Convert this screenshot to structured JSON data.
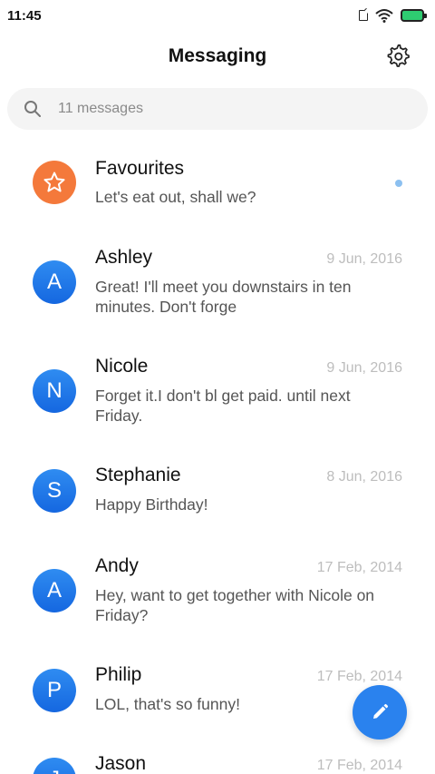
{
  "status_bar": {
    "time": "11:45"
  },
  "header": {
    "title": "Messaging"
  },
  "search": {
    "placeholder": "11 messages"
  },
  "conversations": [
    {
      "avatar": "star-icon",
      "name": "Favourites",
      "date": "",
      "preview": "Let's eat out, shall we?",
      "unread": true,
      "avatar_color": "#f4793b"
    },
    {
      "avatar": "A",
      "name": "Ashley",
      "date": "9 Jun, 2016",
      "preview": "Great! I'll meet you downstairs in ten minutes. Don't forge"
    },
    {
      "avatar": "N",
      "name": "Nicole",
      "date": "9 Jun, 2016",
      "preview": "Forget it.I don't bl get paid. until next Friday."
    },
    {
      "avatar": "S",
      "name": "Stephanie",
      "date": "8 Jun, 2016",
      "preview": "Happy Birthday!"
    },
    {
      "avatar": "A",
      "name": "Andy",
      "date": "17 Feb, 2014",
      "preview": "Hey, want to get together with Nicole on Friday?"
    },
    {
      "avatar": "P",
      "name": "Philip",
      "date": "17 Feb, 2014",
      "preview": "LOL, that's so funny!"
    },
    {
      "avatar": "J",
      "name": "Jason",
      "date": "17 Feb, 2014",
      "preview": ""
    }
  ],
  "fab": {
    "icon": "pencil-icon",
    "color": "#2a82ee"
  },
  "colors": {
    "avatar_blue": "#1e78ea",
    "unread_dot": "#8cc0f0"
  }
}
